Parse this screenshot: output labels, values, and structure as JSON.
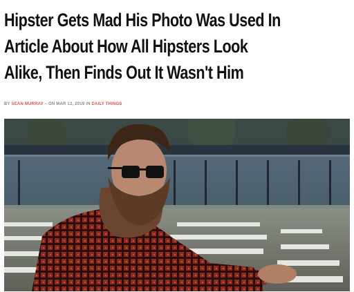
{
  "article": {
    "headline_line1": "Hipster Gets Mad His Photo Was Used In",
    "headline_line2": "Article About How All Hipsters Look",
    "headline_line3": "Alike, Then Finds Out It Wasn't Him",
    "byline_prefix": "BY",
    "author": "SEAN MURRAY",
    "byline_middle": "– ON MAR 12, 2019 IN",
    "section": "DAILY THINGS"
  },
  "colors": {
    "headline": "#111111",
    "byline": "#888888",
    "byline_accent": "#d9534f"
  }
}
